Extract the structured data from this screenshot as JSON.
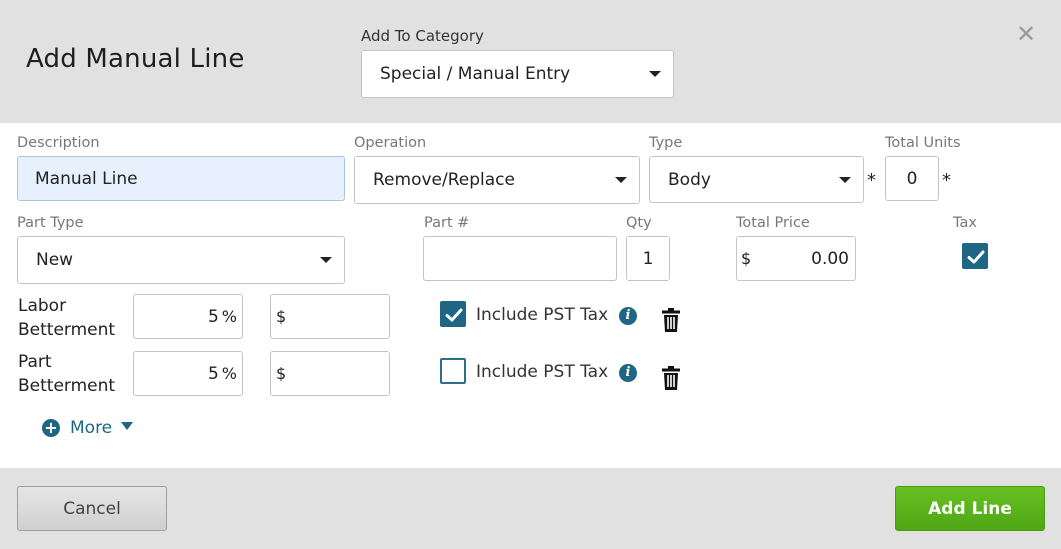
{
  "dialog": {
    "title": "Add Manual Line",
    "category_label": "Add To Category",
    "category_value": "Special / Manual Entry"
  },
  "fields": {
    "description_label": "Description",
    "description_value": "Manual Line",
    "operation_label": "Operation",
    "operation_value": "Remove/Replace",
    "type_label": "Type",
    "type_value": "Body",
    "total_units_label": "Total Units",
    "total_units_value": "0",
    "required_marker": "*",
    "part_type_label": "Part Type",
    "part_type_value": "New",
    "part_number_label": "Part #",
    "part_number_value": "",
    "qty_label": "Qty",
    "qty_value": "1",
    "total_price_label": "Total Price",
    "currency_symbol": "$",
    "total_price_value": "0.00",
    "tax_label": "Tax",
    "tax_checked": true
  },
  "betterment": [
    {
      "label_line1": "Labor",
      "label_line2": "Betterment",
      "percent": "5",
      "percent_unit": "%",
      "amount_prefix": "$",
      "amount": "",
      "include_pst_label": "Include PST Tax",
      "include_pst_checked": true
    },
    {
      "label_line1": "Part",
      "label_line2": "Betterment",
      "percent": "5",
      "percent_unit": "%",
      "amount_prefix": "$",
      "amount": "",
      "include_pst_label": "Include PST Tax",
      "include_pst_checked": false
    }
  ],
  "more_label": "More",
  "footer": {
    "cancel_label": "Cancel",
    "add_label": "Add Line"
  },
  "icons": {
    "close": "close-icon",
    "info": "info-icon",
    "trash": "trash-icon",
    "plus": "plus-circle-icon",
    "dropdown": "caret-down-icon",
    "check": "check-icon"
  },
  "colors": {
    "accent": "#1f6685",
    "primary_button": "#57b01a",
    "header_bg": "#e1e1e1",
    "input_filled_bg": "#e7f0fd"
  }
}
